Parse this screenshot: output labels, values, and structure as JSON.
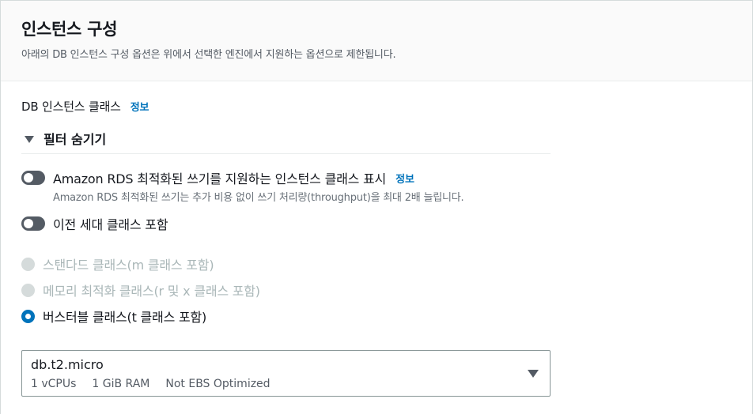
{
  "header": {
    "title": "인스턴스 구성",
    "description": "아래의 DB 인스턴스 구성 옵션은 위에서 선택한 엔진에서 지원하는 옵션으로 제한됩니다."
  },
  "instance_class": {
    "label": "DB 인스턴스 클래스",
    "info": "정보"
  },
  "filter": {
    "toggle_label": "필터 숨기기"
  },
  "toggles": [
    {
      "label": "Amazon RDS 최적화된 쓰기를 지원하는 인스턴스 클래스 표시",
      "info": "정보",
      "description": "Amazon RDS 최적화된 쓰기는 추가 비용 없이 쓰기 처리량(throughput)을 최대 2배 늘립니다.",
      "enabled": false
    },
    {
      "label": "이전 세대 클래스 포함",
      "enabled": false
    }
  ],
  "radios": [
    {
      "label": "스탠다드 클래스(m 클래스 포함)",
      "state": "disabled"
    },
    {
      "label": "메모리 최적화 클래스(r 및 x 클래스 포함)",
      "state": "disabled"
    },
    {
      "label": "버스터블 클래스(t 클래스 포함)",
      "state": "checked"
    }
  ],
  "select": {
    "value": "db.t2.micro",
    "meta": [
      "1 vCPUs",
      "1 GiB RAM",
      "Not EBS Optimized"
    ]
  },
  "colors": {
    "link": "#0073bb",
    "toggle_off": "#545b64",
    "radio_checked": "#0073bb",
    "disabled": "#aab7b8"
  }
}
